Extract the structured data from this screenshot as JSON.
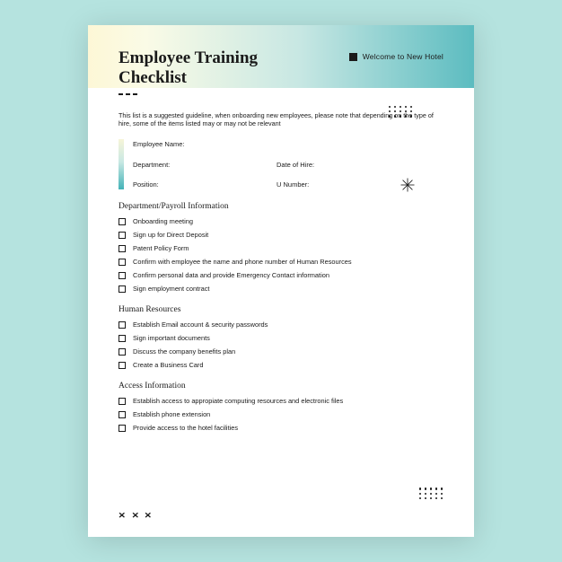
{
  "header": {
    "title": "Employee Training Checklist",
    "welcome": "Welcome to New Hotel"
  },
  "intro": "This list is a suggested guideline, when onboarding new employees, please note that depending on the type of hire, some of the items listed may or may not be relevant",
  "info": {
    "name_label": "Employee Name:",
    "dept_label": "Department:",
    "hire_label": "Date of Hire:",
    "pos_label": "Position:",
    "unum_label": "U Number:"
  },
  "sections": [
    {
      "title": "Department/Payroll Information",
      "items": [
        "Onboarding meeting",
        "Sign up for Direct Deposit",
        "Patent Policy Form",
        "Confirm with employee the name and phone number of Human Resources",
        "Confirm personal data and provide Emergency Contact information",
        "Sign employment contract"
      ]
    },
    {
      "title": "Human Resources",
      "items": [
        "Establish Email account & security passwords",
        "Sign important documents",
        "Discuss the company benefits plan",
        "Create a Business Card"
      ]
    },
    {
      "title": "Access Information",
      "items": [
        "Establish access to appropiate computing resources and electronic files",
        "Establish phone extension",
        "Provide access to the hotel facilities"
      ]
    }
  ]
}
